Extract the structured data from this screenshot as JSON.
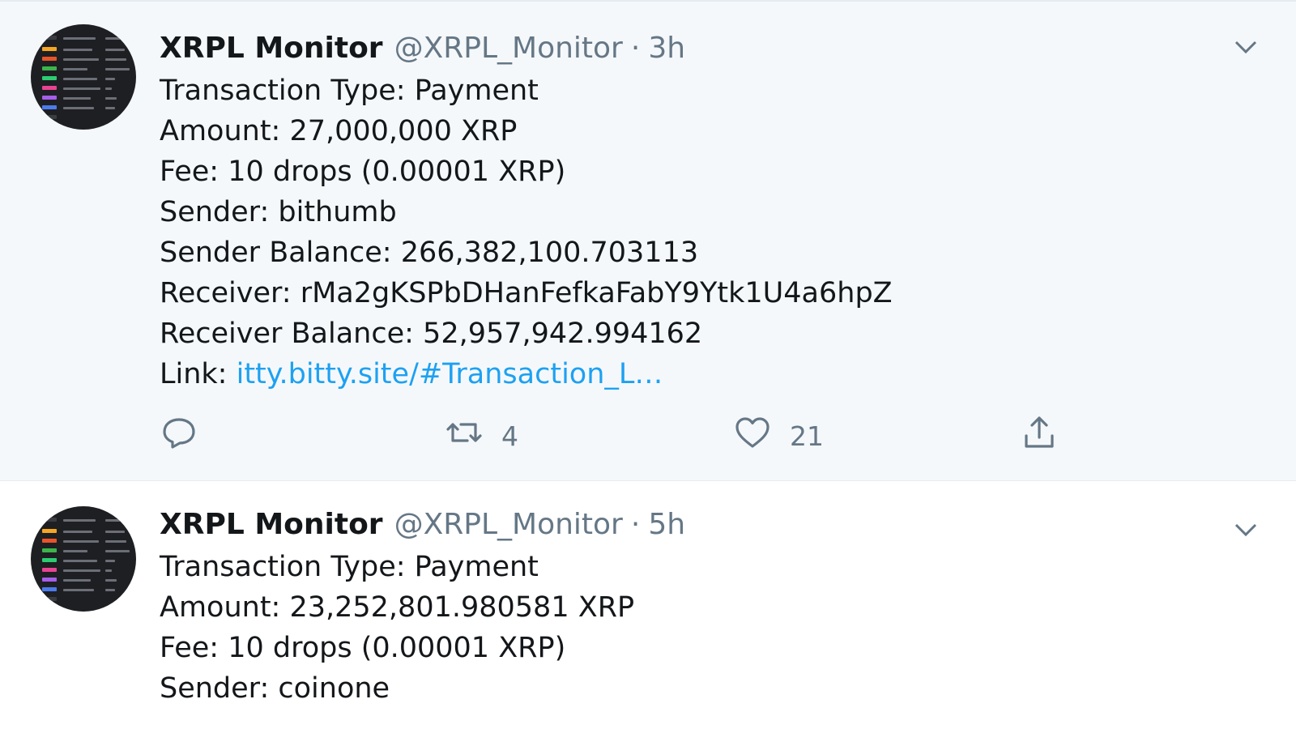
{
  "tweets": [
    {
      "display_name": "XRPL Monitor",
      "handle": "@XRPL_Monitor",
      "separator": "·",
      "time": "3h",
      "lines": {
        "type": "Transaction Type: Payment",
        "amount": "Amount: 27,000,000 XRP",
        "fee": "Fee: 10 drops (0.00001 XRP)",
        "sender": "Sender: bithumb",
        "sender_balance": "Sender Balance: 266,382,100.703113",
        "receiver": "Receiver: rMa2gKSPbDHanFefkaFabY9Ytk1U4a6hpZ",
        "receiver_balance": "Receiver Balance: 52,957,942.994162",
        "link_label": "Link: ",
        "link_text": "itty.bitty.site/#Transaction_L…"
      },
      "actions": {
        "reply_count": "",
        "retweet_count": "4",
        "like_count": "21"
      }
    },
    {
      "display_name": "XRPL Monitor",
      "handle": "@XRPL_Monitor",
      "separator": "·",
      "time": "5h",
      "lines": {
        "type": "Transaction Type: Payment",
        "amount": "Amount: 23,252,801.980581 XRP",
        "fee": "Fee: 10 drops (0.00001 XRP)",
        "sender": "Sender: coinone"
      }
    }
  ],
  "icons": {
    "avatar": "chart-avatar-icon",
    "menu": "chevron-down-icon",
    "reply": "reply-icon",
    "retweet": "retweet-icon",
    "like": "heart-icon",
    "share": "share-icon"
  },
  "colors": {
    "hover_background": "#f5f8fa",
    "text": "#14171a",
    "secondary": "#657786",
    "link": "#1da1f2"
  }
}
